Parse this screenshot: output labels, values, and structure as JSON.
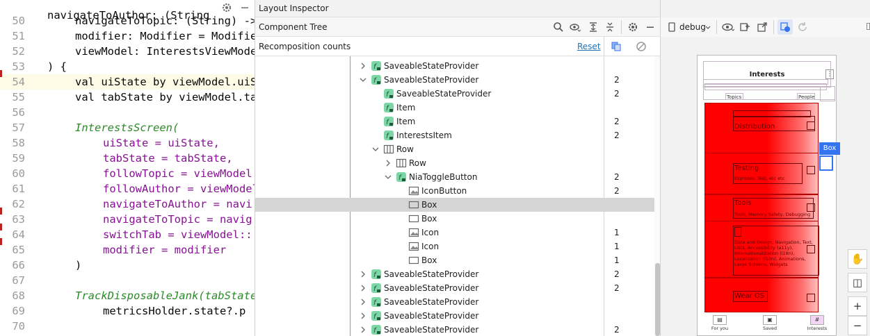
{
  "editor": {
    "top_partial": "navigateToAuthor: (String",
    "lines": [
      {
        "num": "50",
        "html": "navigateToTopic: (String) ->"
      },
      {
        "num": "51",
        "html": "modifier: Modifier = Modifier,"
      },
      {
        "num": "52",
        "html": "viewModel: InterestsViewModel"
      },
      {
        "num": "53",
        "html": ") {"
      },
      {
        "num": "54",
        "html": "val uiState by viewModel.uiState"
      },
      {
        "num": "55",
        "html": "val tabState by viewModel.tab"
      },
      {
        "num": "56",
        "html": ""
      },
      {
        "num": "57",
        "html": "InterestsScreen("
      },
      {
        "num": "58",
        "html": "uiState = uiState,"
      },
      {
        "num": "59",
        "html": "tabState = tabState,"
      },
      {
        "num": "60",
        "html": "followTopic = viewModel"
      },
      {
        "num": "61",
        "html": "followAuthor = viewModel"
      },
      {
        "num": "62",
        "html": "navigateToAuthor = navi"
      },
      {
        "num": "63",
        "html": "navigateToTopic = navig"
      },
      {
        "num": "64",
        "html": "switchTab = viewModel::"
      },
      {
        "num": "65",
        "html": "modifier = modifier"
      },
      {
        "num": "66",
        "html": ")"
      },
      {
        "num": "67",
        "html": ""
      },
      {
        "num": "68",
        "html": "TrackDisposableJank(tabState"
      },
      {
        "num": "69",
        "html": "metricsHolder.state?.p"
      },
      {
        "num": "70",
        "html": ""
      }
    ]
  },
  "inspector": {
    "title": "Layout Inspector",
    "component_tree_label": "Component Tree",
    "recomposition_label": "Recomposition counts",
    "reset_label": "Reset",
    "rows": [
      {
        "name": "SaveableStateProvider",
        "type": "compose",
        "indent": 0,
        "chev": "right",
        "count": ""
      },
      {
        "name": "SaveableStateProvider",
        "type": "compose",
        "indent": 0,
        "chev": "down",
        "count": "2"
      },
      {
        "name": "SaveableStateProvider",
        "type": "compose",
        "indent": 1,
        "chev": "",
        "count": "2"
      },
      {
        "name": "Item",
        "type": "compose",
        "indent": 1,
        "chev": "",
        "count": ""
      },
      {
        "name": "Item",
        "type": "compose",
        "indent": 1,
        "chev": "",
        "count": "2"
      },
      {
        "name": "InterestsItem",
        "type": "compose",
        "indent": 1,
        "chev": "",
        "count": "2"
      },
      {
        "name": "Row",
        "type": "row",
        "indent": 1,
        "chev": "down",
        "count": ""
      },
      {
        "name": "Row",
        "type": "row",
        "indent": 2,
        "chev": "right",
        "count": ""
      },
      {
        "name": "NiaToggleButton",
        "type": "compose",
        "indent": 2,
        "chev": "down",
        "count": "2"
      },
      {
        "name": "IconButton",
        "type": "image",
        "indent": 3,
        "chev": "",
        "count": "2"
      },
      {
        "name": "Box",
        "type": "box",
        "indent": 3,
        "chev": "",
        "count": "",
        "selected": true
      },
      {
        "name": "Box",
        "type": "box",
        "indent": 3,
        "chev": "",
        "count": ""
      },
      {
        "name": "Icon",
        "type": "image",
        "indent": 3,
        "chev": "",
        "count": "1"
      },
      {
        "name": "Icon",
        "type": "image",
        "indent": 3,
        "chev": "",
        "count": "1"
      },
      {
        "name": "Box",
        "type": "box",
        "indent": 3,
        "chev": "",
        "count": "1"
      },
      {
        "name": "SaveableStateProvider",
        "type": "compose",
        "indent": 0,
        "chev": "right",
        "count": "2"
      },
      {
        "name": "SaveableStateProvider",
        "type": "compose",
        "indent": 0,
        "chev": "right",
        "count": "2"
      },
      {
        "name": "SaveableStateProvider",
        "type": "compose",
        "indent": 0,
        "chev": "right",
        "count": ""
      },
      {
        "name": "SaveableStateProvider",
        "type": "compose",
        "indent": 0,
        "chev": "right",
        "count": ""
      },
      {
        "name": "SaveableStateProvider",
        "type": "compose",
        "indent": 0,
        "chev": "right",
        "count": "2"
      }
    ]
  },
  "device": {
    "process_label": "debug",
    "screen_title": "Interests",
    "tab_topics": "Topics",
    "tab_people": "People",
    "box_tag": "Box",
    "items": [
      {
        "title": "Distribution",
        "subtitle": ""
      },
      {
        "title": "Testing",
        "subtitle": "Espresso, Test, etc etc"
      },
      {
        "title": "Tools",
        "subtitle": "Tools, Memory Safety, Debugging"
      },
      {
        "title": "",
        "subtitle": "Data and Design, Navigation, Text, Lists, Accessibility (a11y), Internationalization (i18n), Localization (l10n), Animations, Large Screens, Widgets"
      },
      {
        "title": "Wear OS",
        "subtitle": ""
      }
    ],
    "nav": [
      "For you",
      "Saved",
      "Interests"
    ]
  },
  "colors": {
    "accent": "#3574f0",
    "highlight": "#ff0000",
    "selection": "#d5d5d5"
  }
}
